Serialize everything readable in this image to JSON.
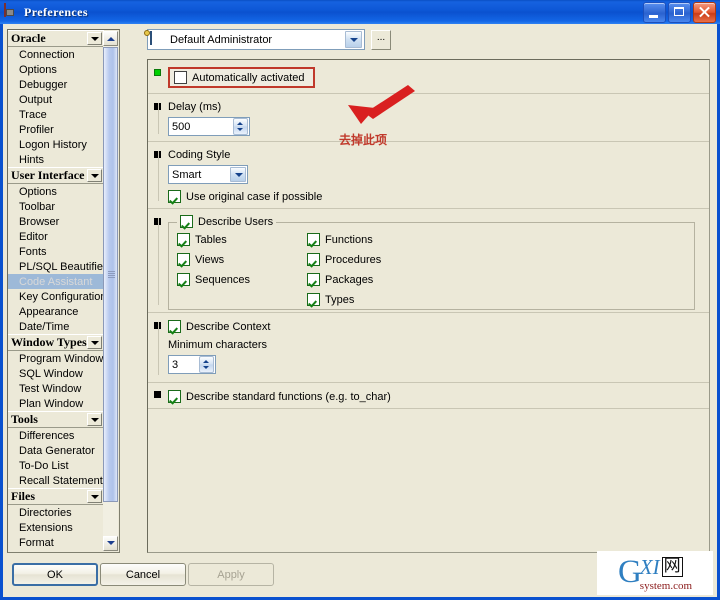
{
  "window": {
    "title": "Preferences",
    "icon": "preferences-icon",
    "minimize_label": "Minimize",
    "maximize_label": "Maximize",
    "close_label": "Close"
  },
  "sidebar": {
    "groups": [
      {
        "label": "Oracle",
        "items": [
          "Connection",
          "Options",
          "Debugger",
          "Output",
          "Trace",
          "Profiler",
          "Logon History",
          "Hints"
        ]
      },
      {
        "label": "User Interface",
        "items": [
          "Options",
          "Toolbar",
          "Browser",
          "Editor",
          "Fonts",
          "PL/SQL Beautifier",
          "Code Assistant",
          "Key Configuration",
          "Appearance",
          "Date/Time"
        ]
      },
      {
        "label": "Window Types",
        "items": [
          "Program Window",
          "SQL Window",
          "Test Window",
          "Plan Window"
        ]
      },
      {
        "label": "Tools",
        "items": [
          "Differences",
          "Data Generator",
          "To-Do List",
          "Recall Statement"
        ]
      },
      {
        "label": "Files",
        "items": [
          "Directories",
          "Extensions",
          "Format"
        ]
      }
    ],
    "selected": "Code Assistant"
  },
  "profile": {
    "value": "Default Administrator",
    "icon": "administrator-icon",
    "browse_label": "...",
    "dropdown_icon": "chevron-down-icon"
  },
  "sections": {
    "auto_activate": {
      "marker": "green",
      "label": "Automatically activated",
      "checked": false
    },
    "delay": {
      "marker": "black",
      "label": "Delay (ms)",
      "value": "500"
    },
    "coding_style": {
      "marker": "black",
      "label": "Coding Style",
      "value": "Smart",
      "original_case": {
        "label": "Use original case if possible",
        "checked": true
      }
    },
    "describe_users": {
      "marker": "black",
      "group_label": "Describe Users",
      "group_checked": true,
      "column1": [
        {
          "label": "Tables",
          "checked": true
        },
        {
          "label": "Views",
          "checked": true
        },
        {
          "label": "Sequences",
          "checked": true
        }
      ],
      "column2": [
        {
          "label": "Functions",
          "checked": true
        },
        {
          "label": "Procedures",
          "checked": true
        },
        {
          "label": "Packages",
          "checked": true
        },
        {
          "label": "Types",
          "checked": true
        }
      ]
    },
    "describe_context": {
      "marker": "black",
      "label": "Describe Context",
      "checked": true,
      "min_chars_label": "Minimum characters",
      "min_chars_value": "3"
    },
    "describe_standard": {
      "marker": "black",
      "label": "Describe standard functions (e.g. to_char)",
      "checked": true
    }
  },
  "annotation": {
    "text": "去掉此项",
    "color": "#c0392b"
  },
  "footer": {
    "ok": "OK",
    "cancel": "Cancel",
    "apply": "Apply",
    "apply_disabled": true
  },
  "watermark": {
    "g": "G",
    "xi": "XI",
    "cn": "网",
    "domain": "system.com"
  }
}
